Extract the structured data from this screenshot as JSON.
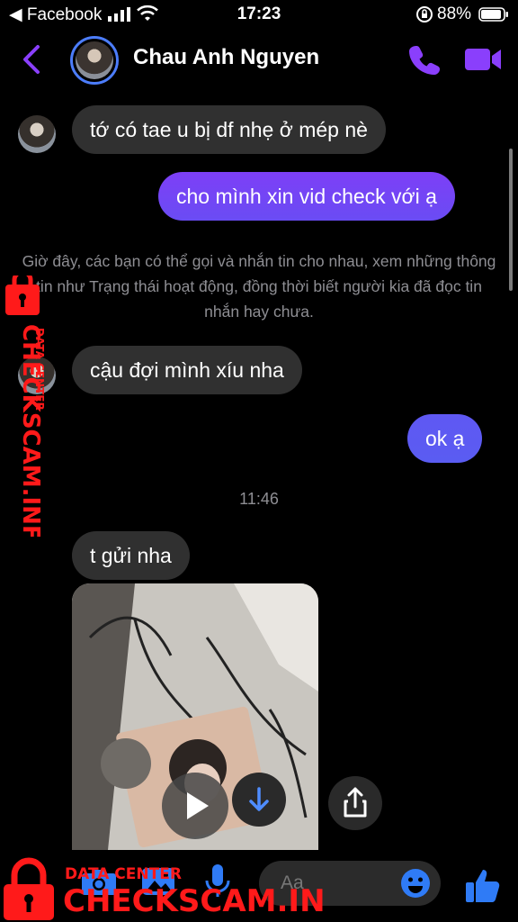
{
  "status_bar": {
    "back_app": "◀ Facebook",
    "time": "17:23",
    "battery_pct": "88%"
  },
  "header": {
    "name": "Chau Anh Nguyen"
  },
  "messages": [
    {
      "dir": "in",
      "text": "tớ có tae u bị df nhẹ ở mép nè"
    },
    {
      "dir": "out",
      "text": "cho mình xin vid check với ạ"
    },
    {
      "dir": "in",
      "text": "cậu đợi mình xíu nha"
    },
    {
      "dir": "out",
      "text": "ok ạ"
    },
    {
      "dir": "in",
      "text": "t gửi nha"
    }
  ],
  "system_notice": "Giờ đây, các bạn có thể gọi và nhắn tin cho nhau, xem những thông tin như Trạng thái hoạt động, đồng thời biết người kia đã đọc tin nhắn hay chưa.",
  "timestamp": "11:46",
  "composer": {
    "placeholder": "Aa"
  },
  "watermark": {
    "line1": "DATA CENTER",
    "line2": "CHECKSCAM.INFO"
  },
  "colors": {
    "accent": "#8a3ffc",
    "bubble_out_top": "#7a3df5",
    "bubble_out_bottom": "#5b5cf2",
    "bubble_in": "#303030",
    "watermark": "#ff1a1a"
  }
}
